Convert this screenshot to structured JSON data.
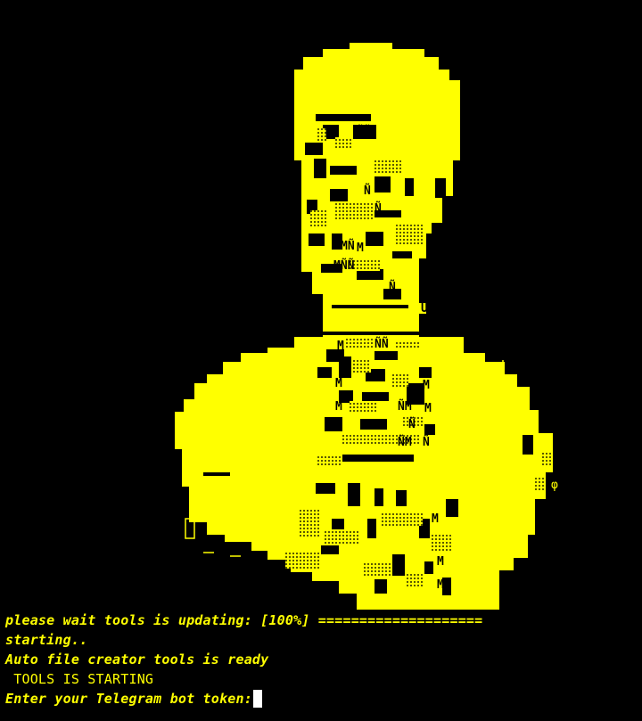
{
  "terminal": {
    "lines": [
      "please wait tools is updating: [100%] ====================",
      "starting..",
      "Auto file creator tools is ready",
      " TOOLS IS STARTING",
      "Enter your Telegram bot token: "
    ]
  },
  "art_glyphs": [
    "M",
    "Ñ",
    "ÑÑ",
    "MÑ",
    "ÑM",
    "MÑÑ",
    "U",
    "φ"
  ],
  "colors": {
    "foreground": "#ffff00",
    "background": "#000000",
    "cursor": "#ffffff"
  }
}
